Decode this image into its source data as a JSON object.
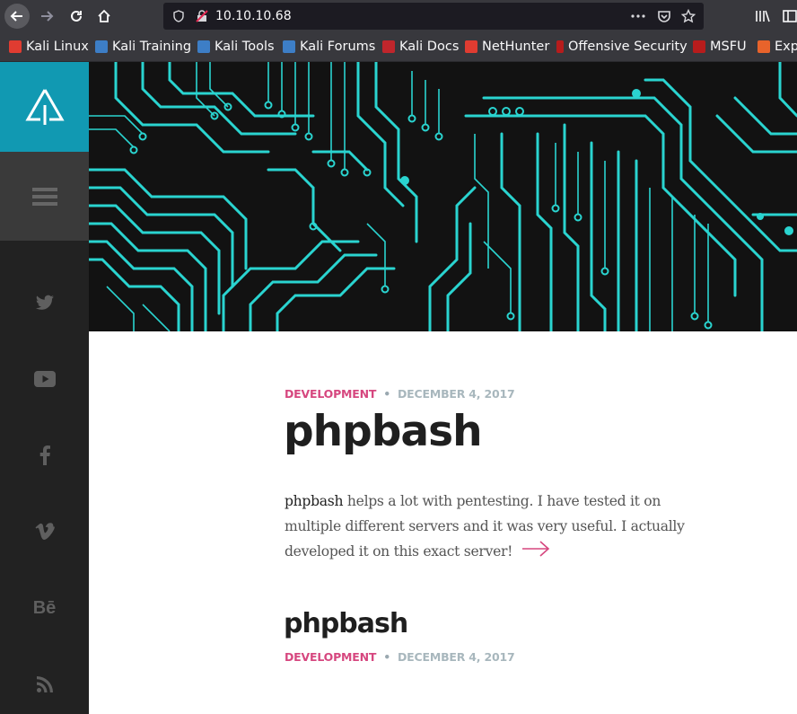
{
  "browser": {
    "url": "10.10.10.68"
  },
  "bookmarks": [
    {
      "label": "Kali Linux",
      "color": "#e03c31"
    },
    {
      "label": "Kali Training",
      "color": "#3d7ec6"
    },
    {
      "label": "Kali Tools",
      "color": "#3d7ec6"
    },
    {
      "label": "Kali Forums",
      "color": "#3d7ec6"
    },
    {
      "label": "Kali Docs",
      "color": "#c0262c"
    },
    {
      "label": "NetHunter",
      "color": "#e03c31"
    },
    {
      "label": "Offensive Security",
      "color": "#b71c1c"
    },
    {
      "label": "MSFU",
      "color": "#b71c1c"
    },
    {
      "label": "Exp",
      "color": "#e8632b"
    }
  ],
  "sidebar": {
    "social": [
      {
        "name": "twitter",
        "glyph": "🐦"
      },
      {
        "name": "youtube",
        "glyph": "▶"
      },
      {
        "name": "facebook",
        "glyph": "f"
      },
      {
        "name": "vimeo",
        "glyph": "v"
      },
      {
        "name": "behance",
        "glyph": "Bē"
      },
      {
        "name": "rss",
        "glyph": "≈"
      }
    ]
  },
  "posts": [
    {
      "category": "DEVELOPMENT",
      "date": "DECEMBER 4, 2017",
      "title": "phpbash",
      "excerpt_lead": "phpbash",
      "excerpt_rest": " helps a lot with pentesting. I have tested it on multiple different servers and it was very useful. I actually developed it on this exact server!"
    },
    {
      "category": "DEVELOPMENT",
      "date": "DECEMBER 4, 2017",
      "title": "phpbash"
    }
  ],
  "colors": {
    "accent": "#1199b2",
    "category": "#d6477f",
    "circuit": "#2ad4d0"
  }
}
